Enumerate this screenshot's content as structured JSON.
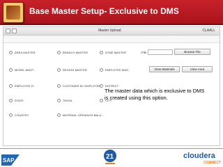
{
  "slide": {
    "title": "Base Master Setup- Exclusive to DMS"
  },
  "app": {
    "window_title": "Master Upload",
    "user_label": "CLAALL",
    "options": [
      {
        "label": "AREA MASTER"
      },
      {
        "label": "BRANCH MASTER"
      },
      {
        "label": "ZONE MASTER"
      },
      {
        "label": "MODEL MAST..."
      },
      {
        "label": "REGION MASTER"
      },
      {
        "label": "EMPLOYEE MAS..."
      },
      {
        "label": "EMPLOYEE R..."
      },
      {
        "label": "CUSTOMER BY EMPLOYEES"
      },
      {
        "label": "DISTRICT"
      },
      {
        "label": "STATE"
      },
      {
        "label": "TEHSIL"
      },
      {
        "label": "CITY"
      },
      {
        "label": "COUNTRY"
      },
      {
        "label": "MATERIAL OPENINGS BALA..."
      }
    ],
    "file_label": "File",
    "browse_button": "Browse File",
    "view_materials_button": "View Materials",
    "view_area_button": "View Area"
  },
  "callout": {
    "text": "The master data which is exclusive to DMS is created using this option."
  },
  "footer": {
    "cloudera_word": "cloudera",
    "cloudera_sub": "CONNECT",
    "sap_text": "SAP",
    "center_logo_text": "21"
  },
  "colors": {
    "title_bar": "#b8181f",
    "cloudera_blue": "#1f5aa6",
    "cloudera_orange": "#f07a1a",
    "sap_blue": "#1f66b3"
  }
}
